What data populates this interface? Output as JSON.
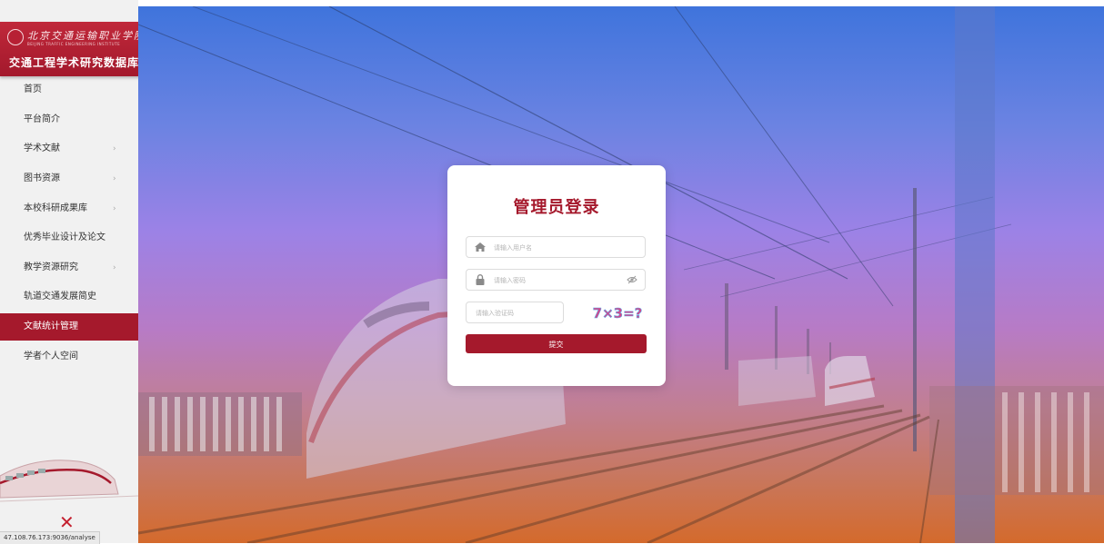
{
  "sidebar": {
    "logo": {
      "school_name": "北京交通运输职业学院",
      "school_name_en": "BEIJING TRAFFIC ENGINEERING INSTITUTE",
      "db_name": "交通工程学术研究数据库"
    },
    "items": [
      {
        "label": "首页",
        "has_children": false,
        "active": false
      },
      {
        "label": "平台简介",
        "has_children": false,
        "active": false
      },
      {
        "label": "学术文献",
        "has_children": true,
        "active": false
      },
      {
        "label": "图书资源",
        "has_children": true,
        "active": false
      },
      {
        "label": "本校科研成果库",
        "has_children": true,
        "active": false
      },
      {
        "label": "优秀毕业设计及论文",
        "has_children": false,
        "active": false
      },
      {
        "label": "教学资源研究",
        "has_children": true,
        "active": false
      },
      {
        "label": "轨道交通发展简史",
        "has_children": false,
        "active": false
      },
      {
        "label": "文献统计管理",
        "has_children": false,
        "active": true
      },
      {
        "label": "学者个人空间",
        "has_children": false,
        "active": false
      }
    ],
    "chevron": "›",
    "close_glyph": "✕"
  },
  "status_bar": {
    "url": "47.108.76.173:9036/analyse"
  },
  "login": {
    "title": "管理员登录",
    "username_placeholder": "请输入用户名",
    "password_placeholder": "请输入密码",
    "captcha_placeholder": "请输入验证码",
    "captcha_text": "7×3=?",
    "submit_label": "提交"
  },
  "colors": {
    "accent": "#a5192c",
    "sidebar_bg": "#f1f1f1",
    "sky_top": "#3f74dc",
    "sky_mid": "#b77bc6",
    "ground": "#d46a2c"
  },
  "icons": [
    "home-icon",
    "lock-icon",
    "eye-icon",
    "close-icon",
    "chevron-right-icon"
  ]
}
